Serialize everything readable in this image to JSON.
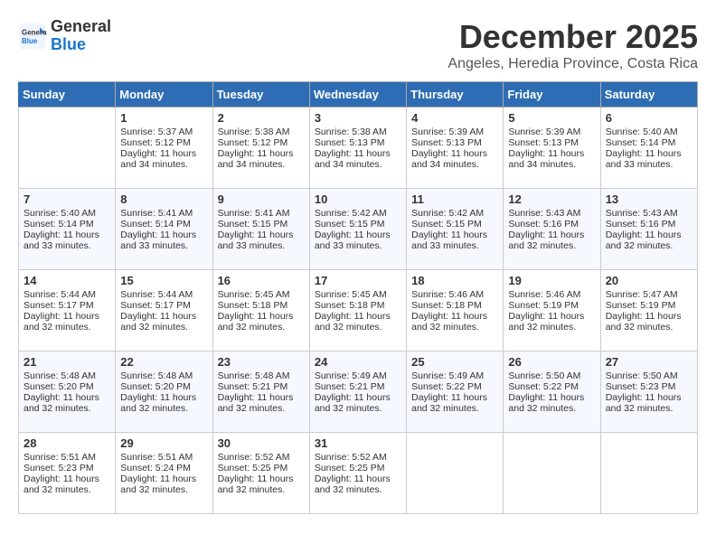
{
  "header": {
    "logo_line1": "General",
    "logo_line2": "Blue",
    "month": "December 2025",
    "location": "Angeles, Heredia Province, Costa Rica"
  },
  "weekdays": [
    "Sunday",
    "Monday",
    "Tuesday",
    "Wednesday",
    "Thursday",
    "Friday",
    "Saturday"
  ],
  "weeks": [
    [
      {
        "day": "",
        "info": ""
      },
      {
        "day": "1",
        "info": "Sunrise: 5:37 AM\nSunset: 5:12 PM\nDaylight: 11 hours\nand 34 minutes."
      },
      {
        "day": "2",
        "info": "Sunrise: 5:38 AM\nSunset: 5:12 PM\nDaylight: 11 hours\nand 34 minutes."
      },
      {
        "day": "3",
        "info": "Sunrise: 5:38 AM\nSunset: 5:13 PM\nDaylight: 11 hours\nand 34 minutes."
      },
      {
        "day": "4",
        "info": "Sunrise: 5:39 AM\nSunset: 5:13 PM\nDaylight: 11 hours\nand 34 minutes."
      },
      {
        "day": "5",
        "info": "Sunrise: 5:39 AM\nSunset: 5:13 PM\nDaylight: 11 hours\nand 34 minutes."
      },
      {
        "day": "6",
        "info": "Sunrise: 5:40 AM\nSunset: 5:14 PM\nDaylight: 11 hours\nand 33 minutes."
      }
    ],
    [
      {
        "day": "7",
        "info": "Sunrise: 5:40 AM\nSunset: 5:14 PM\nDaylight: 11 hours\nand 33 minutes."
      },
      {
        "day": "8",
        "info": "Sunrise: 5:41 AM\nSunset: 5:14 PM\nDaylight: 11 hours\nand 33 minutes."
      },
      {
        "day": "9",
        "info": "Sunrise: 5:41 AM\nSunset: 5:15 PM\nDaylight: 11 hours\nand 33 minutes."
      },
      {
        "day": "10",
        "info": "Sunrise: 5:42 AM\nSunset: 5:15 PM\nDaylight: 11 hours\nand 33 minutes."
      },
      {
        "day": "11",
        "info": "Sunrise: 5:42 AM\nSunset: 5:15 PM\nDaylight: 11 hours\nand 33 minutes."
      },
      {
        "day": "12",
        "info": "Sunrise: 5:43 AM\nSunset: 5:16 PM\nDaylight: 11 hours\nand 32 minutes."
      },
      {
        "day": "13",
        "info": "Sunrise: 5:43 AM\nSunset: 5:16 PM\nDaylight: 11 hours\nand 32 minutes."
      }
    ],
    [
      {
        "day": "14",
        "info": "Sunrise: 5:44 AM\nSunset: 5:17 PM\nDaylight: 11 hours\nand 32 minutes."
      },
      {
        "day": "15",
        "info": "Sunrise: 5:44 AM\nSunset: 5:17 PM\nDaylight: 11 hours\nand 32 minutes."
      },
      {
        "day": "16",
        "info": "Sunrise: 5:45 AM\nSunset: 5:18 PM\nDaylight: 11 hours\nand 32 minutes."
      },
      {
        "day": "17",
        "info": "Sunrise: 5:45 AM\nSunset: 5:18 PM\nDaylight: 11 hours\nand 32 minutes."
      },
      {
        "day": "18",
        "info": "Sunrise: 5:46 AM\nSunset: 5:18 PM\nDaylight: 11 hours\nand 32 minutes."
      },
      {
        "day": "19",
        "info": "Sunrise: 5:46 AM\nSunset: 5:19 PM\nDaylight: 11 hours\nand 32 minutes."
      },
      {
        "day": "20",
        "info": "Sunrise: 5:47 AM\nSunset: 5:19 PM\nDaylight: 11 hours\nand 32 minutes."
      }
    ],
    [
      {
        "day": "21",
        "info": "Sunrise: 5:48 AM\nSunset: 5:20 PM\nDaylight: 11 hours\nand 32 minutes."
      },
      {
        "day": "22",
        "info": "Sunrise: 5:48 AM\nSunset: 5:20 PM\nDaylight: 11 hours\nand 32 minutes."
      },
      {
        "day": "23",
        "info": "Sunrise: 5:48 AM\nSunset: 5:21 PM\nDaylight: 11 hours\nand 32 minutes."
      },
      {
        "day": "24",
        "info": "Sunrise: 5:49 AM\nSunset: 5:21 PM\nDaylight: 11 hours\nand 32 minutes."
      },
      {
        "day": "25",
        "info": "Sunrise: 5:49 AM\nSunset: 5:22 PM\nDaylight: 11 hours\nand 32 minutes."
      },
      {
        "day": "26",
        "info": "Sunrise: 5:50 AM\nSunset: 5:22 PM\nDaylight: 11 hours\nand 32 minutes."
      },
      {
        "day": "27",
        "info": "Sunrise: 5:50 AM\nSunset: 5:23 PM\nDaylight: 11 hours\nand 32 minutes."
      }
    ],
    [
      {
        "day": "28",
        "info": "Sunrise: 5:51 AM\nSunset: 5:23 PM\nDaylight: 11 hours\nand 32 minutes."
      },
      {
        "day": "29",
        "info": "Sunrise: 5:51 AM\nSunset: 5:24 PM\nDaylight: 11 hours\nand 32 minutes."
      },
      {
        "day": "30",
        "info": "Sunrise: 5:52 AM\nSunset: 5:25 PM\nDaylight: 11 hours\nand 32 minutes."
      },
      {
        "day": "31",
        "info": "Sunrise: 5:52 AM\nSunset: 5:25 PM\nDaylight: 11 hours\nand 32 minutes."
      },
      {
        "day": "",
        "info": ""
      },
      {
        "day": "",
        "info": ""
      },
      {
        "day": "",
        "info": ""
      }
    ]
  ]
}
